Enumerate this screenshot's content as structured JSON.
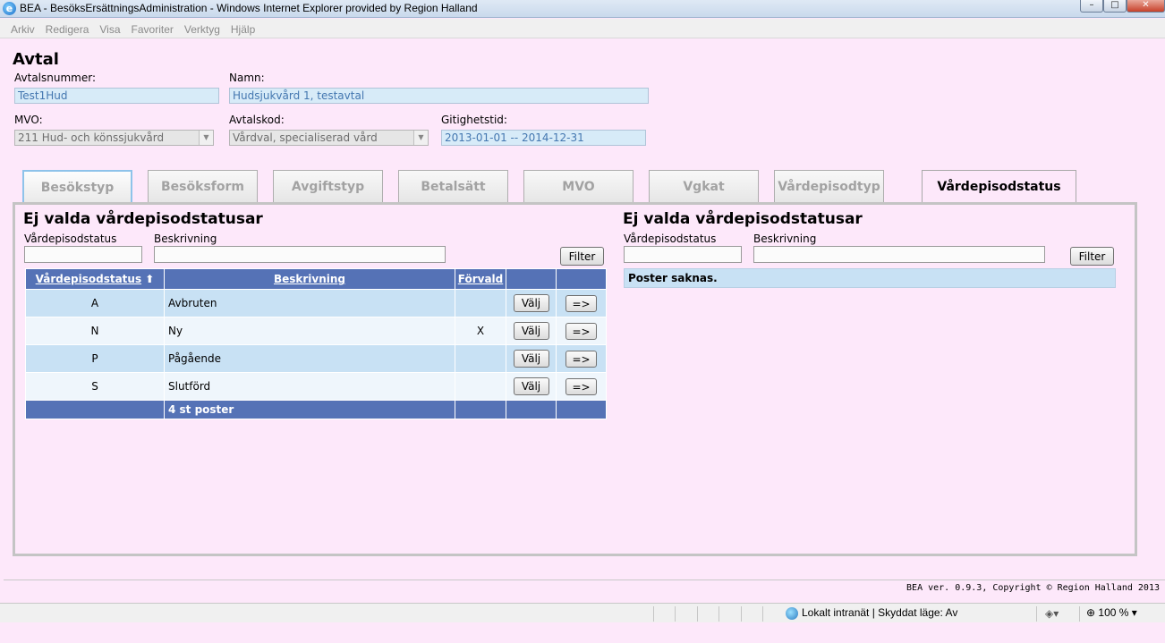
{
  "window": {
    "title": "BEA - BesöksErsättningsAdministration - Windows Internet Explorer provided by Region Halland",
    "minimize": "–",
    "maximize": "□",
    "close": "✕"
  },
  "menu": [
    "Arkiv",
    "Redigera",
    "Visa",
    "Favoriter",
    "Verktyg",
    "Hjälp"
  ],
  "page": {
    "heading": "Avtal",
    "avtalsnummer_label": "Avtalsnummer:",
    "avtalsnummer_value": "Test1Hud",
    "namn_label": "Namn:",
    "namn_value": "Hudsjukvård 1, testavtal",
    "mvo_label": "MVO:",
    "mvo_value": "211 Hud- och könssjukvård",
    "avtalskod_label": "Avtalskod:",
    "avtalskod_value": "Vårdval, specialiserad vård",
    "giltighetstid_label": "Gitighetstid:",
    "giltighetstid_value": "2013-01-01 -- 2014-12-31"
  },
  "tabs": [
    "Besökstyp",
    "Besöksform",
    "Avgiftstyp",
    "Betalsätt",
    "MVO",
    "Vgkat",
    "Vårdepisodtyp",
    "Vårdepisodstatus"
  ],
  "left": {
    "title": "Ej valda vårdepisodstatusar",
    "filter_status_label": "Vårdepisodstatus",
    "filter_desc_label": "Beskrivning",
    "filter_button": "Filter",
    "columns": {
      "status": "Vårdepisodstatus",
      "sort_icon": "⬆",
      "description": "Beskrivning",
      "default": "Förvald"
    },
    "rows": [
      {
        "code": "A",
        "description": "Avbruten",
        "default": "",
        "select": "Välj",
        "move": "=>"
      },
      {
        "code": "N",
        "description": "Ny",
        "default": "X",
        "select": "Välj",
        "move": "=>"
      },
      {
        "code": "P",
        "description": "Pågående",
        "default": "",
        "select": "Välj",
        "move": "=>"
      },
      {
        "code": "S",
        "description": "Slutförd",
        "default": "",
        "select": "Välj",
        "move": "=>"
      }
    ],
    "footer": "4 st poster"
  },
  "right": {
    "title": "Ej valda vårdepisodstatusar",
    "filter_status_label": "Vårdepisodstatus",
    "filter_desc_label": "Beskrivning",
    "filter_button": "Filter",
    "empty_text": "Poster saknas."
  },
  "footer": {
    "copyright": "BEA ver. 0.9.3, Copyright © Region Halland 2013"
  },
  "statusbar": {
    "zone": "Lokalt intranät | Skyddat läge: Av",
    "zoom": "100 %",
    "zoom_icon": "⊕",
    "dropdown_icon": "▾"
  }
}
